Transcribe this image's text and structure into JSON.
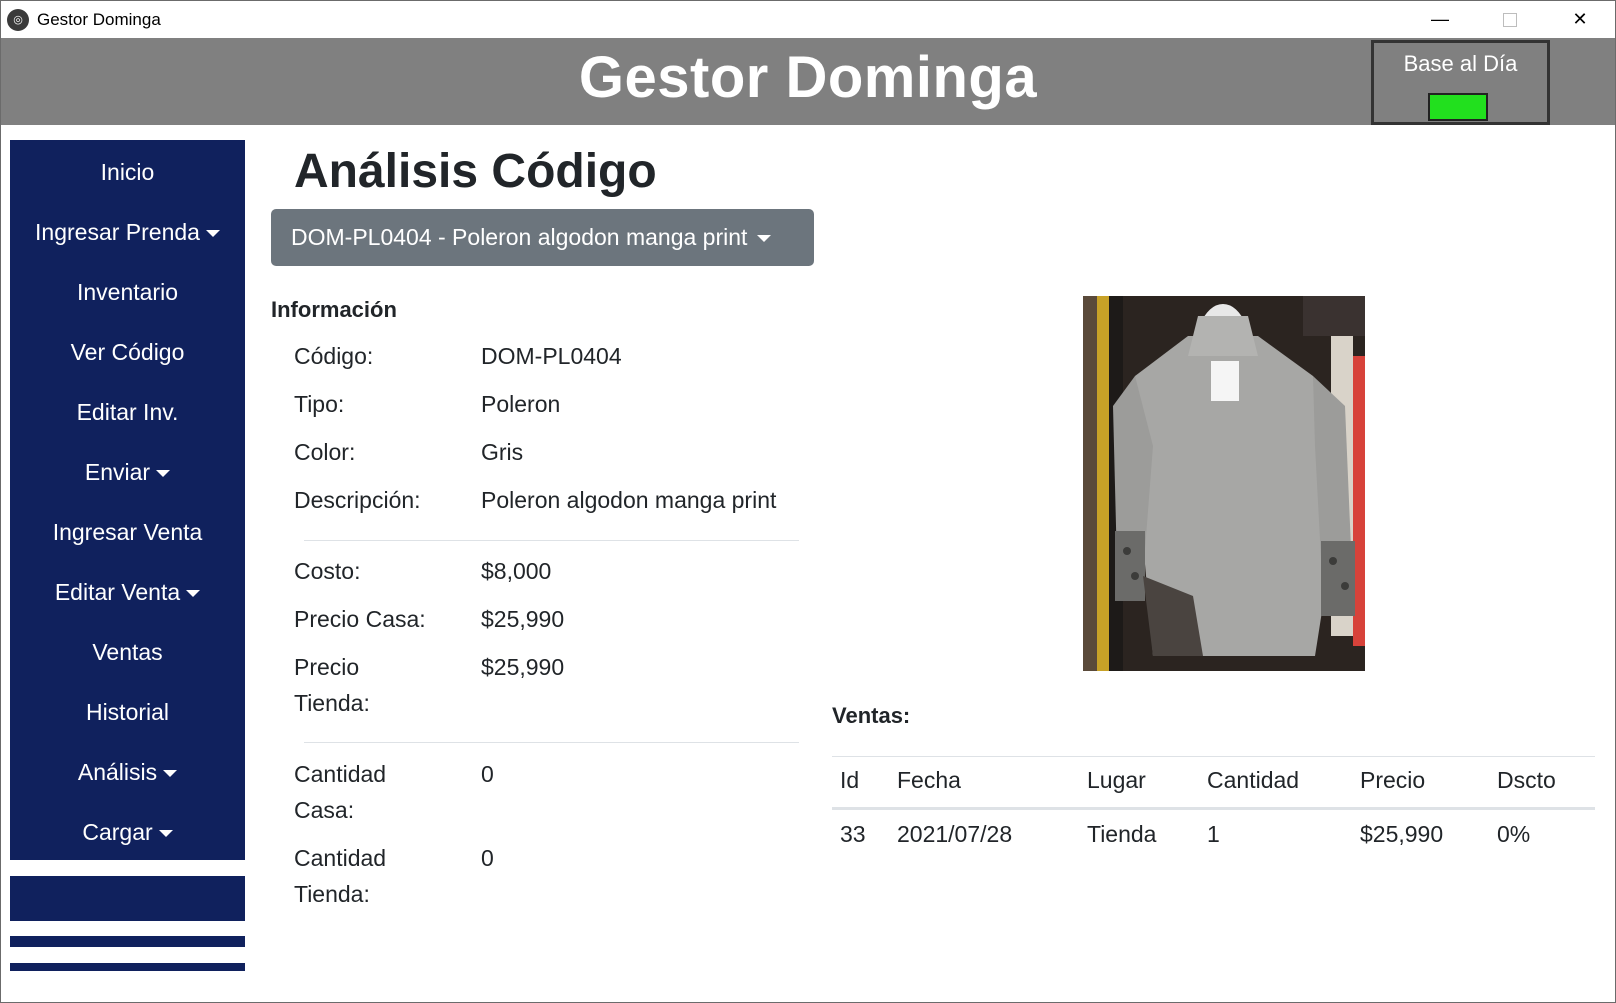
{
  "window": {
    "title": "Gestor Dominga",
    "minimize": "—",
    "close": "✕"
  },
  "header": {
    "title": "Gestor Dominga",
    "status_label": "Base al Día",
    "status_color": "#22e01e"
  },
  "sidebar": {
    "items": [
      {
        "label": "Inicio",
        "dropdown": false
      },
      {
        "label": "Ingresar Prenda",
        "dropdown": true
      },
      {
        "label": "Inventario",
        "dropdown": false
      },
      {
        "label": "Ver Código",
        "dropdown": false
      },
      {
        "label": "Editar Inv.",
        "dropdown": false
      },
      {
        "label": "Enviar",
        "dropdown": true
      },
      {
        "label": "Ingresar Venta",
        "dropdown": false
      },
      {
        "label": "Editar Venta",
        "dropdown": true
      },
      {
        "label": "Ventas",
        "dropdown": false
      },
      {
        "label": "Historial",
        "dropdown": false
      },
      {
        "label": "Análisis",
        "dropdown": true
      },
      {
        "label": "Cargar",
        "dropdown": true
      }
    ]
  },
  "main": {
    "title": "Análisis Código",
    "selected_code": "DOM-PL0404 - Poleron algodon manga print",
    "info_heading": "Información",
    "info": {
      "codigo_label": "Código:",
      "codigo_value": "DOM-PL0404",
      "tipo_label": "Tipo:",
      "tipo_value": "Poleron",
      "color_label": "Color:",
      "color_value": "Gris",
      "descripcion_label": "Descripción:",
      "descripcion_value": "Poleron algodon manga print",
      "costo_label": "Costo:",
      "costo_value": "$8,000",
      "precio_casa_label": "Precio Casa:",
      "precio_casa_value": "$25,990",
      "precio_tienda_label_1": "Precio",
      "precio_tienda_label_2": "Tienda:",
      "precio_tienda_value": "$25,990",
      "cantidad_casa_label_1": "Cantidad",
      "cantidad_casa_label_2": "Casa:",
      "cantidad_casa_value": "0",
      "cantidad_tienda_label_1": "Cantidad",
      "cantidad_tienda_label_2": "Tienda:",
      "cantidad_tienda_value": "0"
    },
    "ventas": {
      "heading": "Ventas:",
      "columns": [
        "Id",
        "Fecha",
        "Lugar",
        "Cantidad",
        "Precio",
        "Dscto"
      ],
      "rows": [
        [
          "33",
          "2021/07/28",
          "Tienda",
          "1",
          "$25,990",
          "0%"
        ]
      ]
    }
  }
}
